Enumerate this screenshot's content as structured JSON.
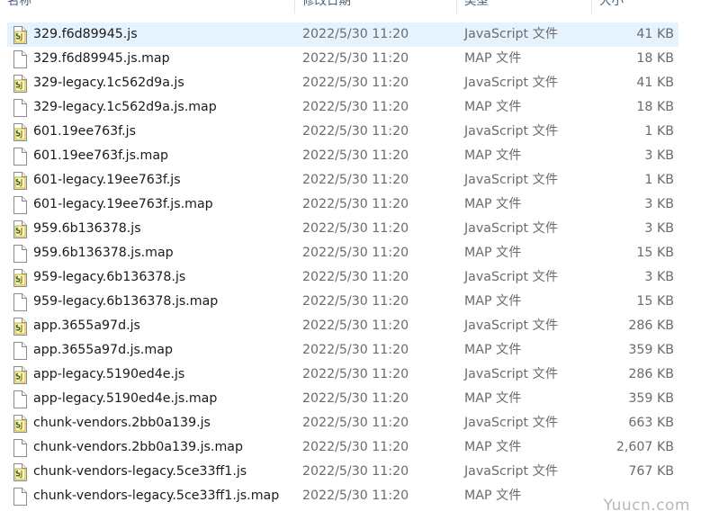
{
  "columns": {
    "name": "名称",
    "date": "修改日期",
    "type": "类型",
    "size": "大小"
  },
  "files": [
    {
      "name": "329.f6d89945.js",
      "date": "2022/5/30 11:20",
      "type": "JavaScript 文件",
      "size": "41 KB",
      "icon": "javascript-file-icon"
    },
    {
      "name": "329.f6d89945.js.map",
      "date": "2022/5/30 11:20",
      "type": "MAP 文件",
      "size": "18 KB",
      "icon": "generic-file-icon"
    },
    {
      "name": "329-legacy.1c562d9a.js",
      "date": "2022/5/30 11:20",
      "type": "JavaScript 文件",
      "size": "41 KB",
      "icon": "javascript-file-icon"
    },
    {
      "name": "329-legacy.1c562d9a.js.map",
      "date": "2022/5/30 11:20",
      "type": "MAP 文件",
      "size": "18 KB",
      "icon": "generic-file-icon"
    },
    {
      "name": "601.19ee763f.js",
      "date": "2022/5/30 11:20",
      "type": "JavaScript 文件",
      "size": "1 KB",
      "icon": "javascript-file-icon"
    },
    {
      "name": "601.19ee763f.js.map",
      "date": "2022/5/30 11:20",
      "type": "MAP 文件",
      "size": "3 KB",
      "icon": "generic-file-icon"
    },
    {
      "name": "601-legacy.19ee763f.js",
      "date": "2022/5/30 11:20",
      "type": "JavaScript 文件",
      "size": "1 KB",
      "icon": "javascript-file-icon"
    },
    {
      "name": "601-legacy.19ee763f.js.map",
      "date": "2022/5/30 11:20",
      "type": "MAP 文件",
      "size": "3 KB",
      "icon": "generic-file-icon"
    },
    {
      "name": "959.6b136378.js",
      "date": "2022/5/30 11:20",
      "type": "JavaScript 文件",
      "size": "3 KB",
      "icon": "javascript-file-icon"
    },
    {
      "name": "959.6b136378.js.map",
      "date": "2022/5/30 11:20",
      "type": "MAP 文件",
      "size": "15 KB",
      "icon": "generic-file-icon"
    },
    {
      "name": "959-legacy.6b136378.js",
      "date": "2022/5/30 11:20",
      "type": "JavaScript 文件",
      "size": "3 KB",
      "icon": "javascript-file-icon"
    },
    {
      "name": "959-legacy.6b136378.js.map",
      "date": "2022/5/30 11:20",
      "type": "MAP 文件",
      "size": "15 KB",
      "icon": "generic-file-icon"
    },
    {
      "name": "app.3655a97d.js",
      "date": "2022/5/30 11:20",
      "type": "JavaScript 文件",
      "size": "286 KB",
      "icon": "javascript-file-icon"
    },
    {
      "name": "app.3655a97d.js.map",
      "date": "2022/5/30 11:20",
      "type": "MAP 文件",
      "size": "359 KB",
      "icon": "generic-file-icon"
    },
    {
      "name": "app-legacy.5190ed4e.js",
      "date": "2022/5/30 11:20",
      "type": "JavaScript 文件",
      "size": "286 KB",
      "icon": "javascript-file-icon"
    },
    {
      "name": "app-legacy.5190ed4e.js.map",
      "date": "2022/5/30 11:20",
      "type": "MAP 文件",
      "size": "359 KB",
      "icon": "generic-file-icon"
    },
    {
      "name": "chunk-vendors.2bb0a139.js",
      "date": "2022/5/30 11:20",
      "type": "JavaScript 文件",
      "size": "663 KB",
      "icon": "javascript-file-icon"
    },
    {
      "name": "chunk-vendors.2bb0a139.js.map",
      "date": "2022/5/30 11:20",
      "type": "MAP 文件",
      "size": "2,607 KB",
      "icon": "generic-file-icon"
    },
    {
      "name": "chunk-vendors-legacy.5ce33ff1.js",
      "date": "2022/5/30 11:20",
      "type": "JavaScript 文件",
      "size": "767 KB",
      "icon": "javascript-file-icon"
    },
    {
      "name": "chunk-vendors-legacy.5ce33ff1.js.map",
      "date": "2022/5/30 11:20",
      "type": "MAP 文件",
      "size": "",
      "icon": "generic-file-icon"
    }
  ],
  "selected_index": 0,
  "watermark": "Yuucn.com",
  "colors": {
    "selected_row": "#e5f3ff",
    "header_text": "#4c607a",
    "js_icon_accent": "#c9b400"
  }
}
